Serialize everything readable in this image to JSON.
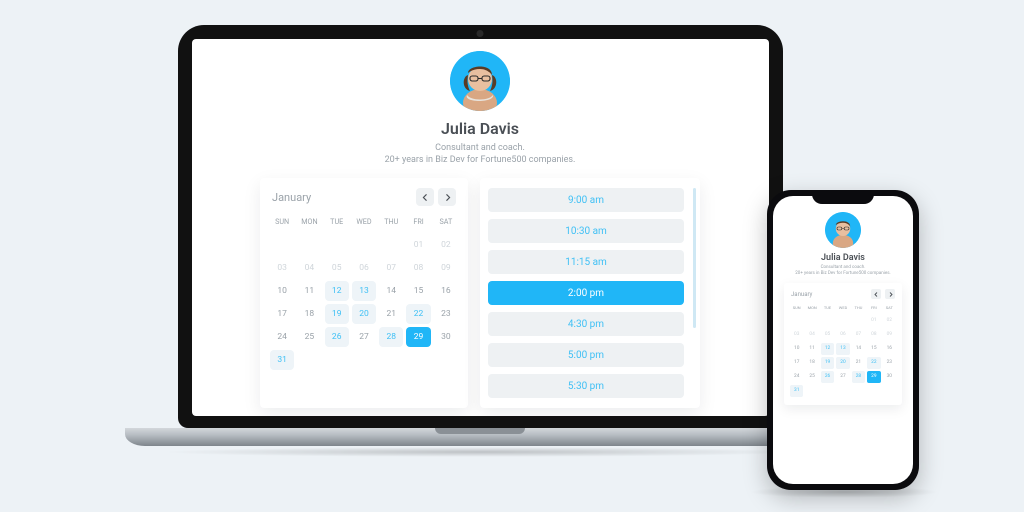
{
  "profile": {
    "name": "Julia Davis",
    "subtitle1": "Consultant and coach.",
    "subtitle2": "20+ years in Biz Dev for Fortune500 companies."
  },
  "calendar": {
    "month_label": "January",
    "dow": [
      "SUN",
      "MON",
      "TUE",
      "WED",
      "THU",
      "FRI",
      "SAT"
    ],
    "cells": [
      {
        "t": "",
        "cls": ""
      },
      {
        "t": "",
        "cls": ""
      },
      {
        "t": "",
        "cls": ""
      },
      {
        "t": "",
        "cls": ""
      },
      {
        "t": "",
        "cls": ""
      },
      {
        "t": "01",
        "cls": "muted"
      },
      {
        "t": "02",
        "cls": "muted"
      },
      {
        "t": "03",
        "cls": "muted"
      },
      {
        "t": "04",
        "cls": "muted"
      },
      {
        "t": "05",
        "cls": "muted"
      },
      {
        "t": "06",
        "cls": "muted"
      },
      {
        "t": "07",
        "cls": "muted"
      },
      {
        "t": "08",
        "cls": "muted"
      },
      {
        "t": "09",
        "cls": "muted"
      },
      {
        "t": "10",
        "cls": ""
      },
      {
        "t": "11",
        "cls": ""
      },
      {
        "t": "12",
        "cls": "avail"
      },
      {
        "t": "13",
        "cls": "avail"
      },
      {
        "t": "14",
        "cls": ""
      },
      {
        "t": "15",
        "cls": ""
      },
      {
        "t": "16",
        "cls": ""
      },
      {
        "t": "17",
        "cls": ""
      },
      {
        "t": "18",
        "cls": ""
      },
      {
        "t": "19",
        "cls": "avail"
      },
      {
        "t": "20",
        "cls": "avail"
      },
      {
        "t": "21",
        "cls": ""
      },
      {
        "t": "22",
        "cls": "avail"
      },
      {
        "t": "23",
        "cls": ""
      },
      {
        "t": "24",
        "cls": ""
      },
      {
        "t": "25",
        "cls": ""
      },
      {
        "t": "26",
        "cls": "avail"
      },
      {
        "t": "27",
        "cls": ""
      },
      {
        "t": "28",
        "cls": "avail"
      },
      {
        "t": "29",
        "cls": "selected"
      },
      {
        "t": "30",
        "cls": ""
      },
      {
        "t": "31",
        "cls": "avail"
      },
      {
        "t": "",
        "cls": ""
      },
      {
        "t": "",
        "cls": ""
      },
      {
        "t": "",
        "cls": ""
      },
      {
        "t": "",
        "cls": ""
      },
      {
        "t": "",
        "cls": ""
      },
      {
        "t": "",
        "cls": ""
      }
    ]
  },
  "slots": [
    {
      "label": "9:00 am",
      "selected": false
    },
    {
      "label": "10:30 am",
      "selected": false
    },
    {
      "label": "11:15 am",
      "selected": false
    },
    {
      "label": "2:00 pm",
      "selected": true
    },
    {
      "label": "4:30 pm",
      "selected": false
    },
    {
      "label": "5:00 pm",
      "selected": false
    },
    {
      "label": "5:30 pm",
      "selected": false
    }
  ],
  "colors": {
    "accent": "#20b6f7"
  }
}
